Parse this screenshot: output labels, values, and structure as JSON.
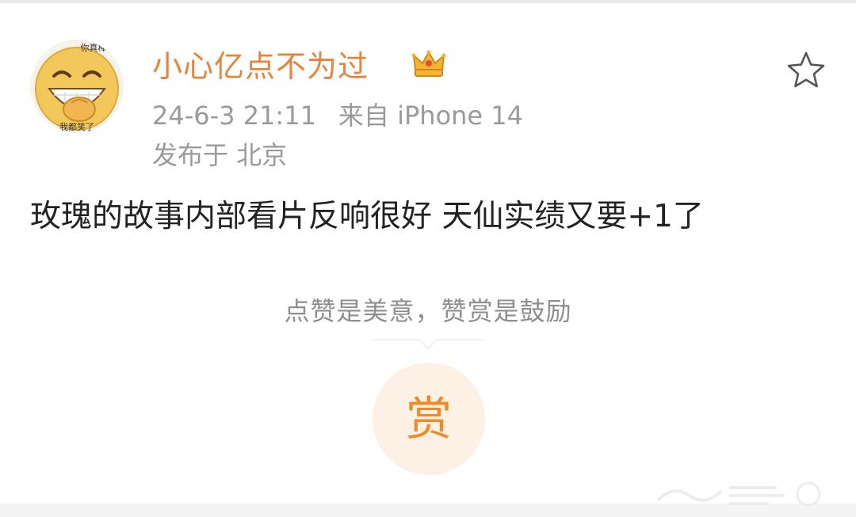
{
  "post": {
    "username": "小心亿点不为过",
    "timestamp": "24-6-3 21:11",
    "source": "来自 iPhone 14",
    "location": "发布于 北京",
    "text": "玫瑰的故事内部看片反响很好 天仙实绩又要+1了"
  },
  "reward": {
    "hint": "点赞是美意，赞赏是鼓励",
    "button_label": "赏"
  },
  "avatar": {
    "caption_top": "你真棒",
    "caption_bottom": "我都笑了"
  },
  "icons": {
    "favorite": "star-outline-icon",
    "badge": "crown-icon",
    "avatar": "laughing-emoji-icon"
  },
  "colors": {
    "username": "#e8833a",
    "meta": "#9a9a9a",
    "reward_accent": "#f08a24",
    "reward_bg": "#fdf1e6"
  }
}
